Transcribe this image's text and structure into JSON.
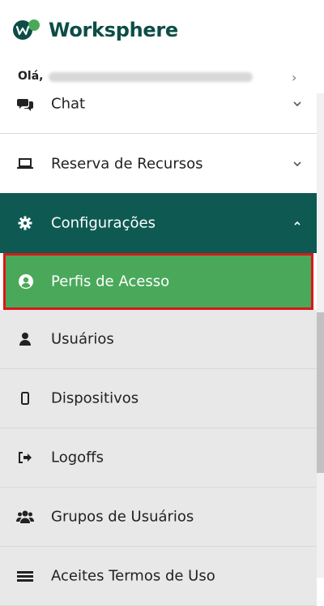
{
  "brand": {
    "name": "Worksphere"
  },
  "greeting": {
    "prefix": "Olá,"
  },
  "menu": {
    "items": [
      {
        "label": "Chat",
        "icon": "chat-icon"
      },
      {
        "label": "Reserva de Recursos",
        "icon": "laptop-icon"
      },
      {
        "label": "Configurações",
        "icon": "gear-icon"
      },
      {
        "label": "Perfis de Acesso",
        "icon": "user-circle-icon"
      },
      {
        "label": "Usuários",
        "icon": "user-icon"
      },
      {
        "label": "Dispositivos",
        "icon": "mobile-icon"
      },
      {
        "label": "Logoffs",
        "icon": "sign-out-icon"
      },
      {
        "label": "Grupos de Usuários",
        "icon": "users-icon"
      },
      {
        "label": "Aceites Termos de Uso",
        "icon": "list-icon"
      }
    ]
  },
  "colors": {
    "brand": "#0d4d47",
    "section_active": "#0e5a53",
    "item_active": "#4aa85a",
    "highlight_border": "#d81818"
  }
}
